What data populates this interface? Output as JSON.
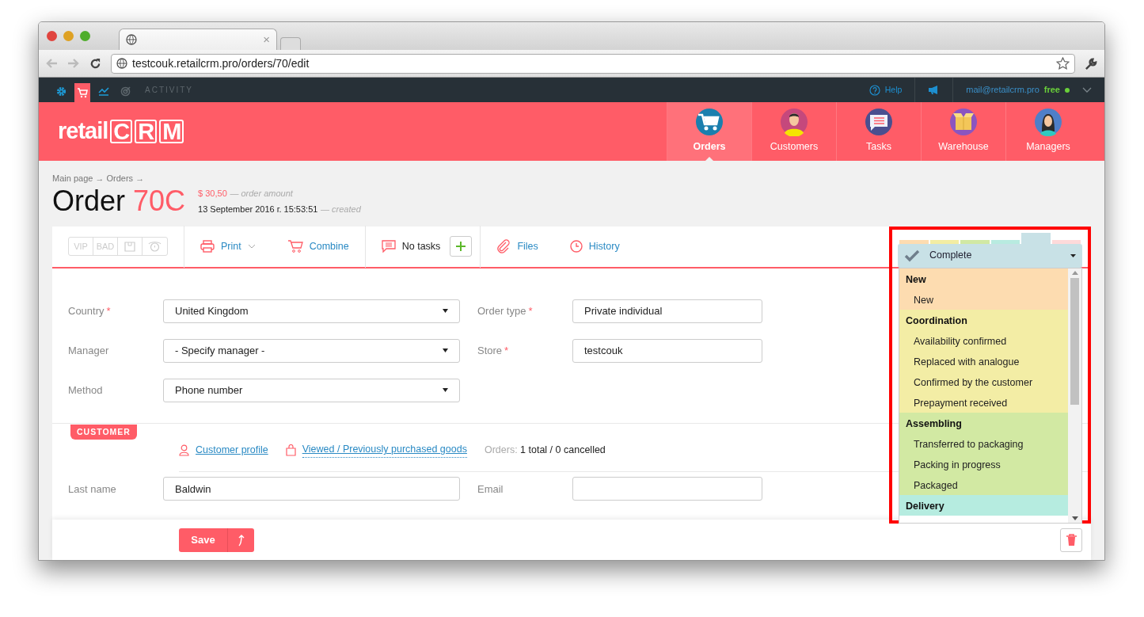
{
  "browser": {
    "url": "testcouk.retailcrm.pro/orders/70/edit",
    "tab_close": "×"
  },
  "topbar": {
    "apps": [
      {
        "kind": "settings",
        "selected": false
      },
      {
        "kind": "cart",
        "selected": true
      },
      {
        "kind": "chart",
        "selected": false
      },
      {
        "kind": "target",
        "selected": false
      }
    ],
    "activity": "ACTIVITY",
    "help": "Help",
    "email": "mail@retailcrm.pro",
    "plan": "free"
  },
  "logo": {
    "text": "retail",
    "letters": [
      "C",
      "R",
      "M"
    ]
  },
  "nav": [
    {
      "label": "Orders",
      "kind": "orders",
      "selected": true
    },
    {
      "label": "Customers",
      "kind": "customers",
      "selected": false
    },
    {
      "label": "Tasks",
      "kind": "tasks",
      "selected": false
    },
    {
      "label": "Warehouse",
      "kind": "warehouse",
      "selected": false
    },
    {
      "label": "Managers",
      "kind": "managers",
      "selected": false
    }
  ],
  "breadcrumb": "Main page → Orders →",
  "order": {
    "title": "Order",
    "number": "70C",
    "amount": "$ 30,50",
    "amount_note": "— order amount",
    "created": "13 September 2016 г. 15:53:51",
    "created_note": "— created"
  },
  "flags": [
    {
      "kind": "text",
      "label": "VIP"
    },
    {
      "kind": "text",
      "label": "BAD"
    },
    {
      "kind": "note"
    },
    {
      "kind": "alarm"
    }
  ],
  "toolbar": [
    {
      "kind": "print",
      "label": "Print",
      "caret": true
    },
    {
      "kind": "combine",
      "label": "Combine"
    },
    {
      "kind": "tasks",
      "label": "No tasks",
      "add": true
    },
    {
      "kind": "files",
      "label": "Files"
    },
    {
      "kind": "history",
      "label": "History"
    }
  ],
  "status": {
    "value": "Complete",
    "tabs": [
      {
        "color": "#fddcb0",
        "selected": false
      },
      {
        "color": "#f3eda3",
        "selected": false
      },
      {
        "color": "#d1e8a4",
        "selected": false
      },
      {
        "color": "#b8ebe0",
        "selected": false
      },
      {
        "color": "#c8e1e6",
        "selected": true
      },
      {
        "color": "#fddada",
        "selected": false
      }
    ],
    "groups": [
      {
        "name": "New",
        "color": "#fddcb0",
        "items": [
          "New"
        ]
      },
      {
        "name": "Coordination",
        "color": "#f3eda5",
        "items": [
          "Availability confirmed",
          "Replaced with analogue",
          "Confirmed by the customer",
          "Prepayment received"
        ]
      },
      {
        "name": "Assembling",
        "color": "#d2e9a3",
        "items": [
          "Transferred to packaging",
          "Packing in progress",
          "Packaged"
        ]
      },
      {
        "name": "Delivery",
        "color": "#b6ece0"
      }
    ]
  },
  "form": {
    "required_mark": "*",
    "left": [
      {
        "label": "Country",
        "required": true,
        "value": "United Kingdom",
        "kind": "select"
      },
      {
        "label": "Manager",
        "required": false,
        "value": "- Specify manager -",
        "kind": "select"
      },
      {
        "label": "Method",
        "required": false,
        "value": "Phone number",
        "kind": "select"
      }
    ],
    "right": [
      {
        "label": "Order type",
        "required": true,
        "value": "Private individual"
      },
      {
        "label": "Store",
        "required": true,
        "value": "testcouk"
      }
    ]
  },
  "customer": {
    "badge": "CUSTOMER",
    "links": [
      {
        "kind": "profile",
        "label": "Customer profile"
      },
      {
        "kind": "goods",
        "label": "Viewed / Previously purchased goods"
      }
    ],
    "orders_label": "Orders:",
    "orders_value": "1 total / 0 cancelled",
    "fields": [
      {
        "label": "Last name",
        "value": "Baldwin"
      },
      {
        "label": "Email"
      }
    ]
  },
  "save": "Save"
}
